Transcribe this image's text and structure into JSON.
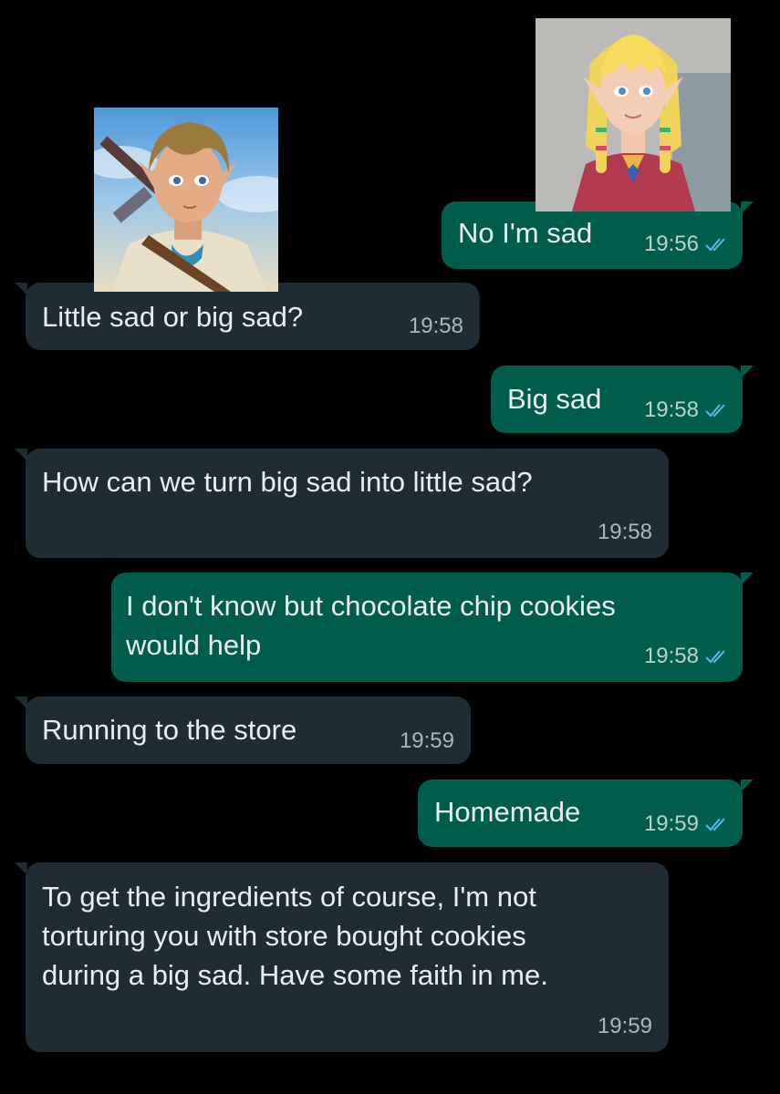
{
  "colors": {
    "background": "#000000",
    "incoming_bubble": "#1f2c33",
    "outgoing_bubble": "#005c4b",
    "text": "#e9edef",
    "read_ticks": "#53bdeb"
  },
  "avatars": {
    "left": {
      "icon": "green-tunic-character-portrait"
    },
    "right": {
      "icon": "blonde-princess-character-portrait"
    }
  },
  "messages": [
    {
      "direction": "out",
      "text": "No I'm sad",
      "time": "19:56",
      "status": "read"
    },
    {
      "direction": "in",
      "text": "Little sad or big sad?",
      "time": "19:58"
    },
    {
      "direction": "out",
      "text": "Big sad",
      "time": "19:58",
      "status": "read"
    },
    {
      "direction": "in",
      "text": "How can we turn big sad into little sad?",
      "time": "19:58"
    },
    {
      "direction": "out",
      "text": "I don't know but chocolate chip cookies\nwould help",
      "time": "19:58",
      "status": "read"
    },
    {
      "direction": "in",
      "text": "Running to the store",
      "time": "19:59"
    },
    {
      "direction": "out",
      "text": "Homemade",
      "time": "19:59",
      "status": "read"
    },
    {
      "direction": "in",
      "text": "To get the ingredients of course, I'm not\ntorturing you with store bought cookies\nduring a big sad. Have some faith in me.",
      "time": "19:59"
    }
  ]
}
